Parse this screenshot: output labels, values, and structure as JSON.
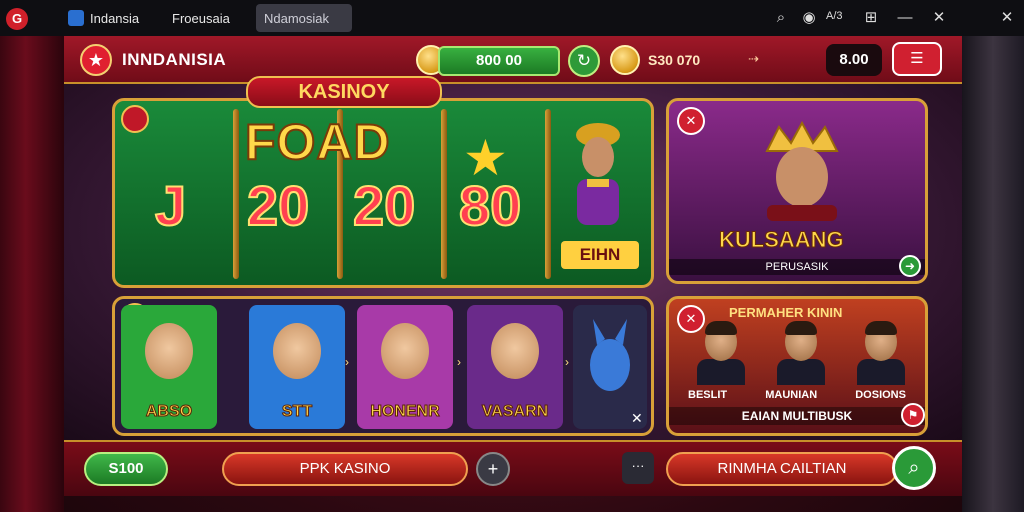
{
  "window": {
    "app_icon": "G",
    "tabs": [
      {
        "label": "Indansia"
      },
      {
        "label": "Froeusaia"
      },
      {
        "label": "Ndamosiak"
      }
    ],
    "zoom": "A/3",
    "buttons": {
      "min": "—",
      "close": "✕",
      "x_far": "✕"
    }
  },
  "topbar": {
    "brand": "INNDANISIA",
    "balance": "800 00",
    "gold_label": "S30 070",
    "arrow": "⇢",
    "value": "8.00",
    "menu_glyph": "☰"
  },
  "slot": {
    "title": "KASINOY",
    "big_word": "FOAD",
    "numbers": [
      "J",
      "20",
      "20",
      "80"
    ],
    "char_label": "EIHN"
  },
  "promo": {
    "title": "KULSAANG",
    "subtitle": "PERUSASIK",
    "go": "➜"
  },
  "games": {
    "cards": [
      {
        "label": "ABSO",
        "bg": "#2aa83a"
      },
      {
        "label": "STT",
        "bg": "#2a7ad8"
      },
      {
        "label": "HONENR",
        "bg": "#a83aa8"
      },
      {
        "label": "VASARN",
        "bg": "#6a2a8a"
      },
      {
        "label": "",
        "bg": "#2a2a4a"
      }
    ]
  },
  "multi": {
    "title": "PERMAHER KININ",
    "names": [
      "BESLIT",
      "MAUNIAN",
      "DOSIONS"
    ],
    "subtitle": "EAIAN MULTIBUSK"
  },
  "bottombar": {
    "green_pill": "S100",
    "main_pill": "PPK KASINO",
    "plus": "+",
    "more": "···",
    "right_pill": "RINMHA CAILTIAN"
  },
  "colors": {
    "accent_red": "#d02030",
    "accent_gold": "#d8a038",
    "accent_green": "#2a9a38"
  }
}
